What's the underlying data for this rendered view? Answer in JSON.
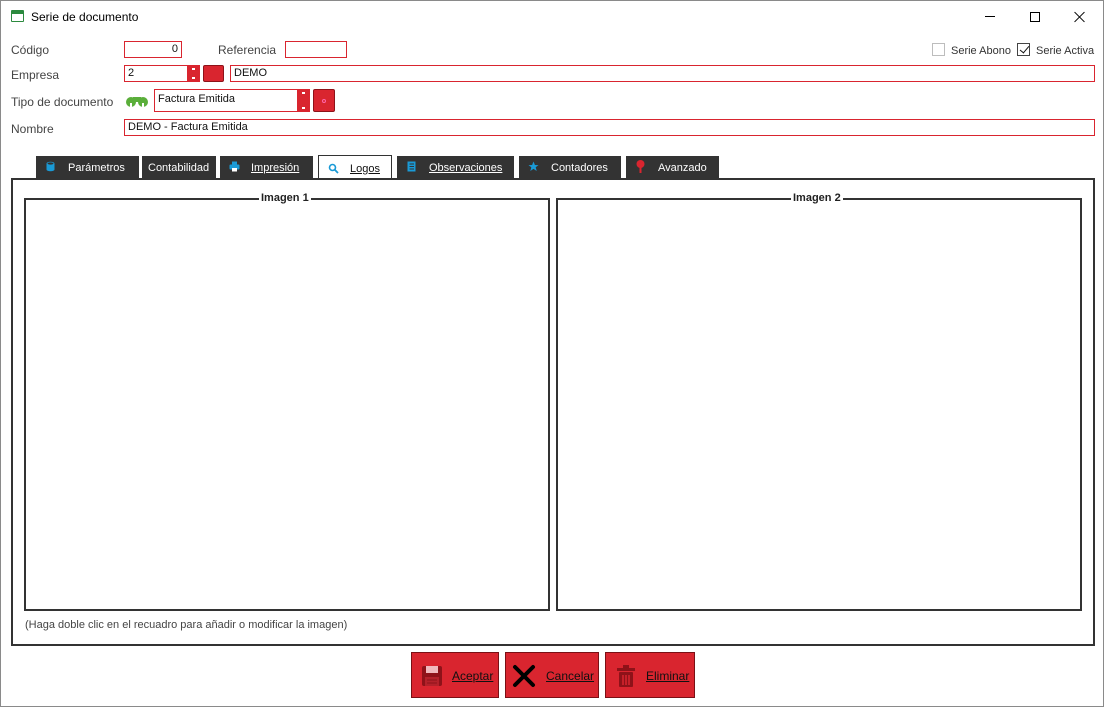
{
  "window": {
    "title": "Serie de documento"
  },
  "form": {
    "codigo_label": "Código",
    "codigo_value": "0",
    "referencia_label": "Referencia",
    "referencia_value": "",
    "empresa_label": "Empresa",
    "empresa_value": "2",
    "empresa_name": "DEMO",
    "tipo_label": "Tipo de documento",
    "tipo_value": "Factura Emitida",
    "nombre_label": "Nombre",
    "nombre_value": "DEMO - Factura Emitida",
    "serie_abono_label": "Serie Abono",
    "serie_abono_checked": false,
    "serie_activa_label": "Serie Activa",
    "serie_activa_checked": true
  },
  "tabs": [
    {
      "label": "Parámetros",
      "icon": "database-icon",
      "active": false
    },
    {
      "label": "Contabilidad",
      "icon": "",
      "active": false
    },
    {
      "label": "Impresión",
      "icon": "printer-icon",
      "active": false
    },
    {
      "label": "Logos",
      "icon": "search-icon",
      "active": true
    },
    {
      "label": "Observaciones",
      "icon": "notebook-icon",
      "active": false
    },
    {
      "label": "Contadores",
      "icon": "star-icon",
      "active": false
    },
    {
      "label": "Avanzado",
      "icon": "pin-icon",
      "active": false
    }
  ],
  "logos": {
    "image1_title": "Imagen 1",
    "image2_title": "Imagen 2",
    "hint": "(Haga doble clic en el recuadro para añadir o modificar la imagen)"
  },
  "actions": {
    "accept_label": "Aceptar",
    "cancel_label": "Cancelar",
    "delete_label": "Eliminar"
  },
  "colors": {
    "accent": "#d9252f",
    "tab_dark": "#333333",
    "icon_blue": "#1a9ad6",
    "icon_green": "#5aae3a"
  }
}
